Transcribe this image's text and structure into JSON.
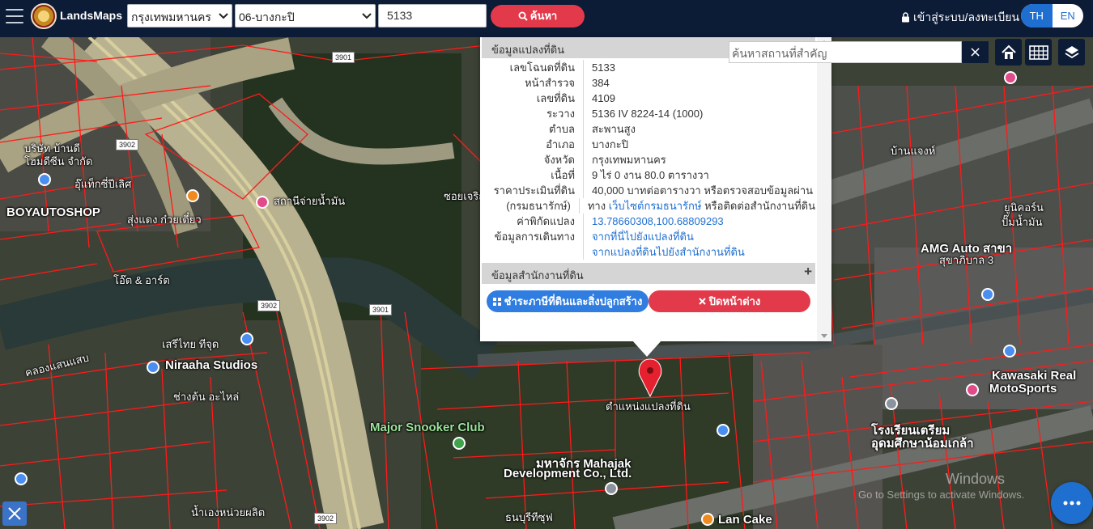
{
  "app": {
    "brand": "LandsMaps"
  },
  "search": {
    "province": "กรุงเทพมหานคร",
    "district": "06-บางกะปิ",
    "parcel_number": "5133",
    "button_label": "ค้นหา"
  },
  "auth": {
    "login_label": "เข้าสู่ระบบ/ลงทะเบียน"
  },
  "language": {
    "th": "TH",
    "en": "EN",
    "active": "TH"
  },
  "popup": {
    "title": "ข้อมูลแปลงที่ดิน",
    "rows": [
      {
        "label": "เลขโฉนดที่ดิน",
        "value": "5133"
      },
      {
        "label": "หน้าสำรวจ",
        "value": "384"
      },
      {
        "label": "เลขที่ดิน",
        "value": "4109"
      },
      {
        "label": "ระวาง",
        "value": "5136 IV 8224-14 (1000)"
      },
      {
        "label": "ตำบล",
        "value": "สะพานสูง"
      },
      {
        "label": "อำเภอ",
        "value": "บางกะปิ"
      },
      {
        "label": "จังหวัด",
        "value": "กรุงเทพมหานคร"
      },
      {
        "label": "เนื้อที่",
        "value": "9 ไร่ 0 งาน 80.0 ตารางวา"
      },
      {
        "label": "ราคาประเมินที่ดิน",
        "value": "40,000 บาทต่อตารางวา หรือตรวจสอบข้อมูลผ่าน"
      },
      {
        "label": "(กรมธนารักษ์)",
        "value_prefix": "ทาง",
        "value_link": "เว็บไซต์กรมธนารักษ์",
        "value_suffix": "หรือติดต่อสำนักงานที่ดิน"
      },
      {
        "label": "ค่าพิกัดแปลง",
        "link": "13.78660308,100.68809293"
      },
      {
        "label": "ข้อมูลการเดินทาง",
        "link": "จากที่นี่ไปยังแปลงที่ดิน"
      },
      {
        "label": "",
        "link": "จากแปลงที่ดินไปยังสำนักงานที่ดิน"
      }
    ],
    "office_section": "ข้อมูลสำนักงานที่ดิน",
    "office_expand": "+",
    "tax_button": "ชำระภาษีที่ดินและสิ่งปลูกสร้าง",
    "close_button": "ปิดหน้าต่าง"
  },
  "place_search": {
    "placeholder": "ค้นหาสถานที่สำคัญ",
    "clear": "×"
  },
  "map": {
    "labels": [
      {
        "text": "บริษัท บ้านดี",
        "cls": ""
      },
      {
        "text": "โฮมดีซีน จำกัด",
        "cls": ""
      },
      {
        "text": "อุ๊แท็กซี่ปีเลิศ",
        "cls": ""
      },
      {
        "text": "BOYAUTOSHOP",
        "cls": "big"
      },
      {
        "text": "สุ่งแดง ก๋วยเตี๋ยว",
        "cls": ""
      },
      {
        "text": "สถานีจ่ายน้ำมัน",
        "cls": ""
      },
      {
        "text": "โอ๊ต & อาร์ต",
        "cls": ""
      },
      {
        "text": "เสรีไทย ทีจุด",
        "cls": ""
      },
      {
        "text": "Niraaha Studios",
        "cls": "big"
      },
      {
        "text": "ช่างต้น อะไหล่",
        "cls": ""
      },
      {
        "text": "Major Snooker Club",
        "cls": "big green"
      },
      {
        "text": "ตำแหน่งแปลงที่ดิน",
        "cls": ""
      },
      {
        "text": "มหาจักร Mahajak",
        "cls": "big"
      },
      {
        "text": "Development Co., Ltd.",
        "cls": "big"
      },
      {
        "text": "AMG Auto สาขา",
        "cls": "big"
      },
      {
        "text": "สุขาภิบาล 3",
        "cls": ""
      },
      {
        "text": "Kawasaki Real",
        "cls": "big"
      },
      {
        "text": "MotoSports",
        "cls": "big"
      },
      {
        "text": "โรงเรียนเตรียม",
        "cls": "big"
      },
      {
        "text": "อุดมศึกษาน้อมเกล้า",
        "cls": "big"
      },
      {
        "text": "ซอยเจริญ",
        "cls": ""
      },
      {
        "text": "คลองแสนแสบ",
        "cls": ""
      },
      {
        "text": "Lan Cake",
        "cls": "big"
      },
      {
        "text": "บ้านแจงห์",
        "cls": ""
      },
      {
        "text": "ยูนิคอร์น",
        "cls": ""
      },
      {
        "text": "ปั๊มน้ำมัน",
        "cls": ""
      },
      {
        "text": "ธนบุรีทีซุฟ",
        "cls": ""
      },
      {
        "text": "น้ำเองหน่วยผลิต",
        "cls": ""
      }
    ],
    "road_numbers": [
      "3901",
      "3902",
      "3902",
      "3901",
      "3902"
    ]
  },
  "watermark": {
    "line1": "Windows",
    "line2": "Go to Settings to activate Windows."
  },
  "colors": {
    "navbar": "#0c1b36",
    "accent_red": "#e23a4b",
    "accent_blue": "#2f7de1",
    "parcel_line": "#ff1a1a"
  }
}
